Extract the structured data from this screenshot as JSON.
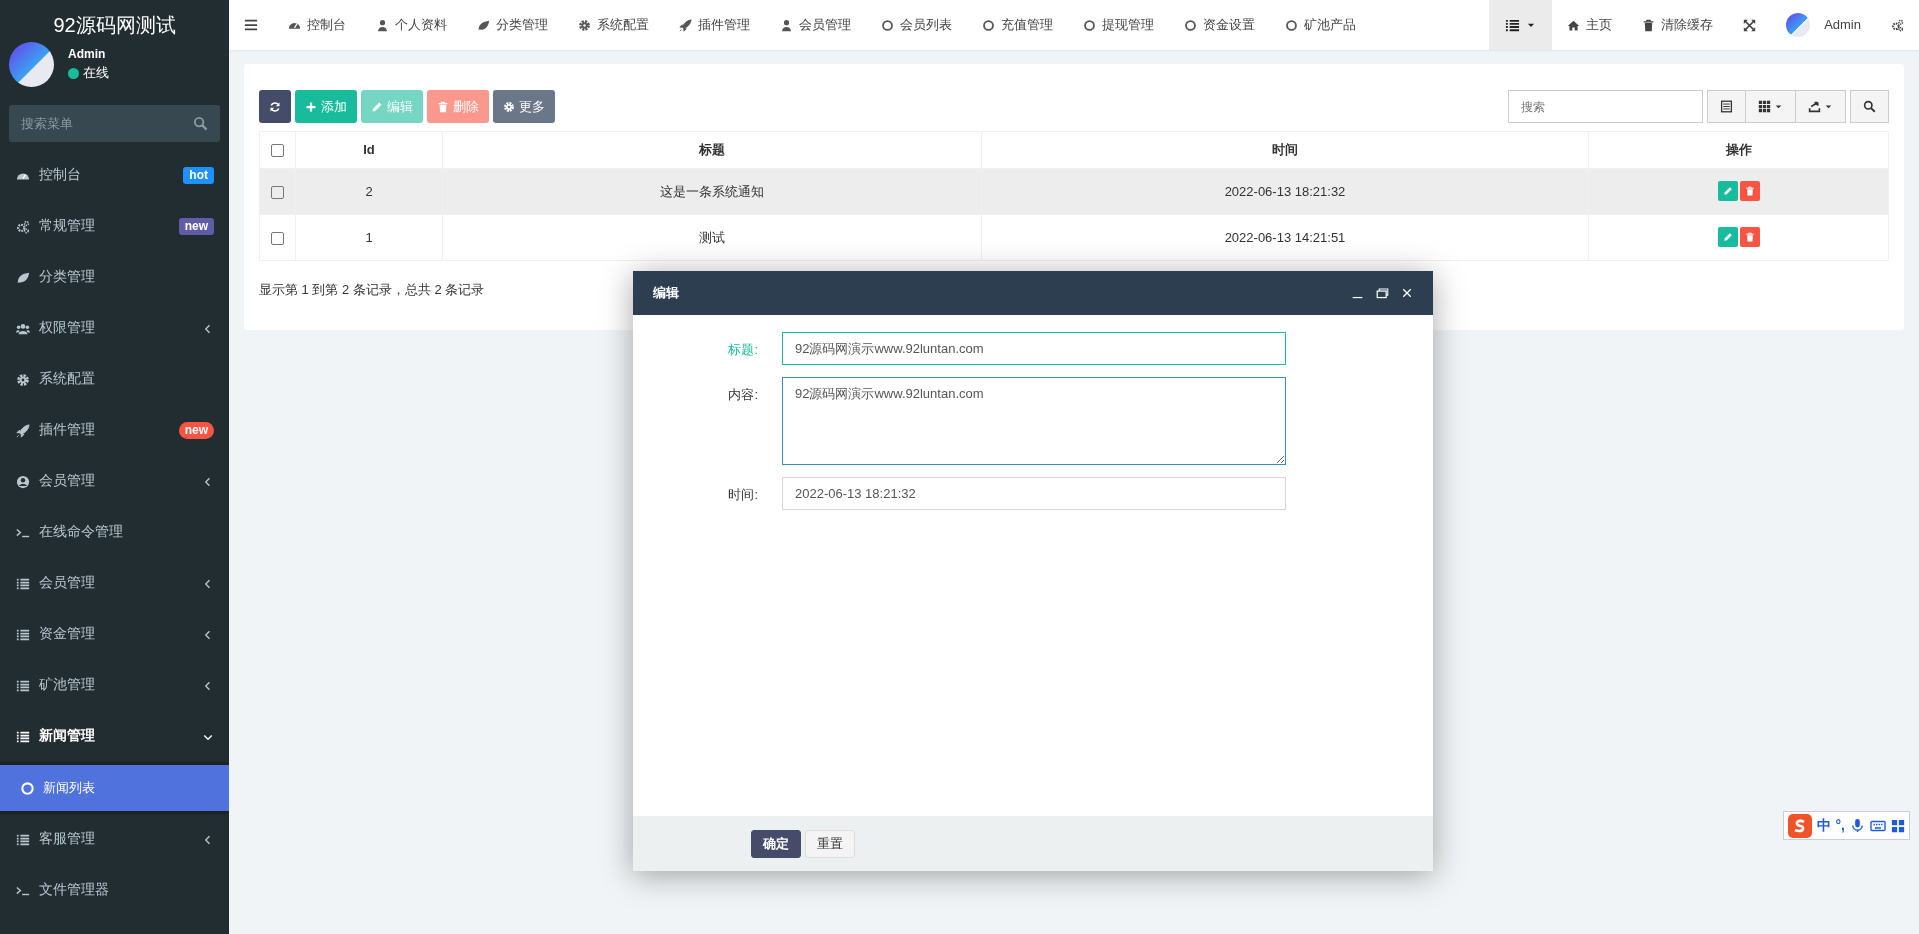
{
  "sidebar": {
    "title": "92源码网测试",
    "user": {
      "name": "Admin",
      "status": "在线",
      "online": true
    },
    "search": {
      "placeholder": "搜索菜单"
    },
    "items": [
      {
        "kind": "dashboard",
        "label": "控制台",
        "badge": {
          "text": "hot",
          "color": "#1e90ff",
          "pill": false
        },
        "expandable": false,
        "expanded": false
      },
      {
        "kind": "cogs",
        "label": "常规管理",
        "badge": {
          "text": "new",
          "color": "#605ca8",
          "pill": false
        },
        "expandable": false,
        "expanded": false
      },
      {
        "kind": "leaf",
        "label": "分类管理",
        "expandable": false,
        "expanded": false
      },
      {
        "kind": "users",
        "label": "权限管理",
        "expandable": true,
        "expanded": false
      },
      {
        "kind": "gear",
        "label": "系统配置",
        "expandable": false,
        "expanded": false
      },
      {
        "kind": "rocket",
        "label": "插件管理",
        "badge": {
          "text": "new",
          "color": "#f75444",
          "pill": true
        },
        "expandable": false,
        "expanded": false
      },
      {
        "kind": "user-circle",
        "label": "会员管理",
        "expandable": true,
        "expanded": false
      },
      {
        "kind": "terminal",
        "label": "在线命令管理",
        "expandable": false,
        "expanded": false
      },
      {
        "kind": "list",
        "label": "会员管理",
        "expandable": true,
        "expanded": false
      },
      {
        "kind": "list",
        "label": "资金管理",
        "expandable": true,
        "expanded": false
      },
      {
        "kind": "list",
        "label": "矿池管理",
        "expandable": true,
        "expanded": false
      },
      {
        "kind": "list",
        "label": "新闻管理",
        "expandable": true,
        "expanded": true,
        "children": [
          {
            "kind": "circle",
            "label": "新闻列表",
            "selected": true
          }
        ]
      },
      {
        "kind": "list",
        "label": "客服管理",
        "expandable": true,
        "expanded": false
      },
      {
        "kind": "terminal",
        "label": "文件管理器",
        "expandable": false,
        "expanded": false
      }
    ]
  },
  "topbar": {
    "tabs": [
      {
        "kind": "dashboard",
        "label": "控制台"
      },
      {
        "kind": "user",
        "label": "个人资料"
      },
      {
        "kind": "leaf",
        "label": "分类管理"
      },
      {
        "kind": "gear",
        "label": "系统配置"
      },
      {
        "kind": "rocket",
        "label": "插件管理"
      },
      {
        "kind": "user",
        "label": "会员管理"
      },
      {
        "kind": "circle",
        "label": "会员列表"
      },
      {
        "kind": "circle",
        "label": "充值管理"
      },
      {
        "kind": "circle",
        "label": "提现管理"
      },
      {
        "kind": "circle",
        "label": "资金设置"
      },
      {
        "kind": "circle",
        "label": "矿池产品"
      }
    ],
    "right": [
      {
        "kind": "dropdown",
        "active": true
      },
      {
        "kind": "home",
        "label": "主页",
        "active": false
      },
      {
        "kind": "trash",
        "label": "清除缓存",
        "active": false
      },
      {
        "kind": "expand",
        "active": false
      },
      {
        "kind": "user",
        "label": "Admin",
        "active": false
      },
      {
        "kind": "cogs",
        "active": false
      }
    ]
  },
  "toolbar": {
    "buttons": [
      {
        "kind": "refresh",
        "disabled": false
      },
      {
        "kind": "add",
        "label": "添加",
        "disabled": false
      },
      {
        "kind": "edit",
        "label": "编辑",
        "disabled": true
      },
      {
        "kind": "delete",
        "label": "删除",
        "disabled": true
      },
      {
        "kind": "more",
        "label": "更多",
        "disabled": false
      }
    ],
    "search": {
      "placeholder": "搜索"
    },
    "tools": [
      {
        "kind": "table",
        "dropdown": false
      },
      {
        "kind": "grid",
        "dropdown": true
      },
      {
        "kind": "export",
        "dropdown": true
      },
      {
        "kind": "search",
        "dropdown": false
      }
    ]
  },
  "table": {
    "select_all": {
      "checked": false
    },
    "columns": [
      "Id",
      "标题",
      "时间",
      "操作"
    ],
    "rows": [
      {
        "checked": false,
        "hovered": true,
        "cells": [
          "2",
          "这是一条系统通知",
          "2022-06-13 18:21:32"
        ]
      },
      {
        "checked": false,
        "hovered": false,
        "cells": [
          "1",
          "测试",
          "2022-06-13 14:21:51"
        ]
      }
    ],
    "summary": "显示第 1 到第 2 条记录，总共 2 条记录"
  },
  "dialog": {
    "title": "编辑",
    "fields": [
      {
        "kind": "input",
        "label": "标题:",
        "value": "92源码网演示www.92luntan.com",
        "valid": true,
        "focused": false
      },
      {
        "kind": "textarea",
        "label": "内容:",
        "value": "92源码网演示www.92luntan.com",
        "valid": false,
        "focused": true
      },
      {
        "kind": "input",
        "label": "时间:",
        "value": "2022-06-13 18:21:32",
        "valid": false,
        "focused": false
      }
    ],
    "buttons": [
      {
        "label": "确定",
        "primary": true
      },
      {
        "label": "重置",
        "primary": false
      }
    ]
  },
  "ime": {
    "mode": "中",
    "punctuation": "°,"
  }
}
